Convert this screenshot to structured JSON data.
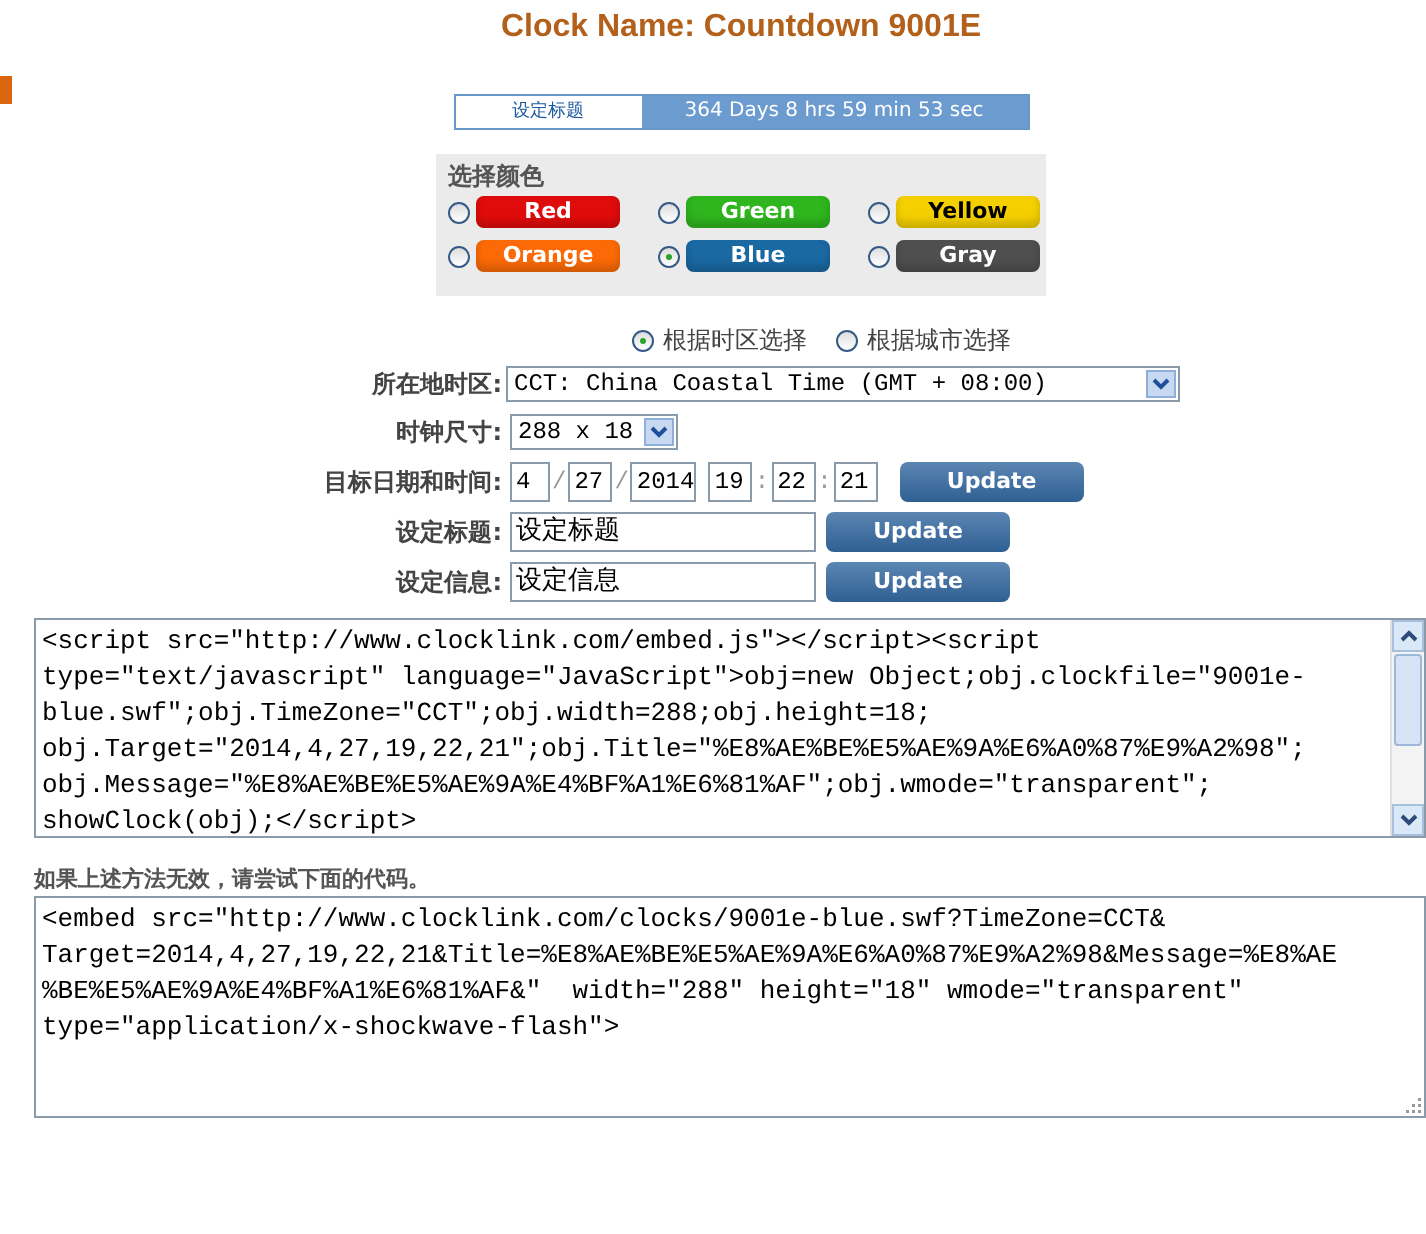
{
  "page_title": "Clock Name: Countdown 9001E",
  "preview": {
    "label": "设定标题",
    "countdown": "364 Days 8 hrs 59 min 53 sec"
  },
  "color_panel": {
    "heading": "选择颜色",
    "options": [
      {
        "label": "Red",
        "color": "#e00b0b",
        "selected": false
      },
      {
        "label": "Green",
        "color": "#2fb51e",
        "selected": false
      },
      {
        "label": "Yellow",
        "color": "#f4d000",
        "selected": false
      },
      {
        "label": "Orange",
        "color": "#fb6a06",
        "selected": false
      },
      {
        "label": "Blue",
        "color": "#1a69a3",
        "selected": true
      },
      {
        "label": "Gray",
        "color": "#4f4f4f",
        "selected": false
      }
    ]
  },
  "mode_radios": [
    {
      "label": "根据时区选择",
      "selected": true
    },
    {
      "label": "根据城市选择",
      "selected": false
    }
  ],
  "timezone": {
    "label": "所在地时区:",
    "value": "CCT: China Coastal Time (GMT + 08:00)"
  },
  "size": {
    "label": "时钟尺寸:",
    "value": "288 x 18"
  },
  "target": {
    "label": "目标日期和时间:",
    "parts": [
      {
        "kind": "field",
        "value": "4"
      },
      {
        "kind": "sep",
        "text": "/"
      },
      {
        "kind": "field",
        "value": "27"
      },
      {
        "kind": "sep",
        "text": "/"
      },
      {
        "kind": "field",
        "value": "2014"
      },
      {
        "kind": "gap"
      },
      {
        "kind": "field",
        "value": "19"
      },
      {
        "kind": "sep",
        "text": ":"
      },
      {
        "kind": "field",
        "value": "22"
      },
      {
        "kind": "sep",
        "text": ":"
      },
      {
        "kind": "field",
        "value": "21"
      }
    ],
    "button": "Update"
  },
  "title_row": {
    "label": "设定标题:",
    "value": "设定标题",
    "button": "Update"
  },
  "message_row": {
    "label": "设定信息:",
    "value": "设定信息",
    "button": "Update"
  },
  "script_code": {
    "lines": [
      "<script src=\"http://www.clocklink.com/embed.js\"></script><script",
      "type=\"text/javascript\" language=\"JavaScript\">obj=new Object;obj.clockfile=\"9001e-",
      "blue.swf\";obj.TimeZone=\"CCT\";obj.width=288;obj.height=18;",
      "obj.Target=\"2014,4,27,19,22,21\";obj.Title=\"%E8%AE%BE%E5%AE%9A%E6%A0%87%E9%A2%98\";",
      "obj.Message=\"%E8%AE%BE%E5%AE%9A%E4%BF%A1%E6%81%AF\";obj.wmode=\"transparent\";",
      "showClock(obj);</script>"
    ]
  },
  "fallback_note": "如果上述方法无效，请尝试下面的代码。",
  "embed_code": {
    "lines": [
      "<embed src=\"http://www.clocklink.com/clocks/9001e-blue.swf?TimeZone=CCT&",
      "Target=2014,4,27,19,22,21&Title=%E8%AE%BE%E5%AE%9A%E6%A0%87%E9%A2%98&Message=%E8%AE",
      "%BE%E5%AE%9A%E4%BF%A1%E6%81%AF&\"  width=\"288\" height=\"18\" wmode=\"transparent\"",
      "type=\"application/x-shockwave-flash\">"
    ]
  }
}
